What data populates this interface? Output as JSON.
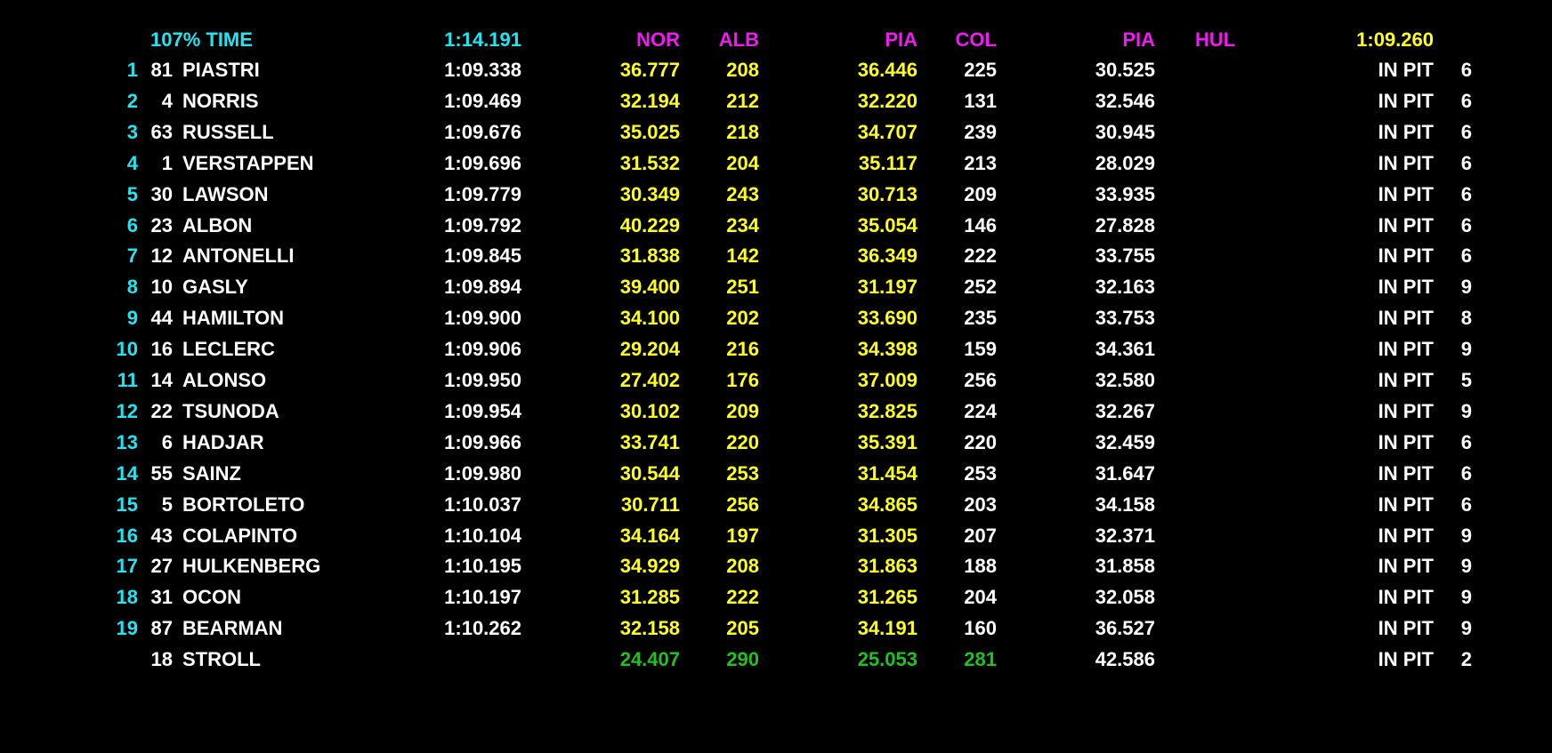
{
  "colors": {
    "background": "#000000",
    "header_label": "#22e5f2",
    "position": "#22e5f2",
    "text": "#ffffff",
    "sector": "#ffff1e",
    "best_marker": "#ee1cee",
    "personal_best": "#22c022"
  },
  "header": {
    "label": "107% TIME",
    "cutoff_time": "1:14.191",
    "best_s1_driver": "NOR",
    "best_sp1_driver": "ALB",
    "best_s2_driver": "PIA",
    "best_sp2_driver": "COL",
    "best_s3_driver": "PIA",
    "best_sp3_driver": "HUL",
    "best_lap_time": "1:09.260"
  },
  "rows": [
    {
      "pos": "1",
      "num": "81",
      "name": "PIASTRI",
      "lap": "1:09.338",
      "s1": "36.777",
      "sp1": "208",
      "s2": "36.446",
      "sp2": "225",
      "s3": "30.525",
      "sp3": "",
      "status": "IN PIT",
      "laps": "6"
    },
    {
      "pos": "2",
      "num": "4",
      "name": "NORRIS",
      "lap": "1:09.469",
      "s1": "32.194",
      "sp1": "212",
      "s2": "32.220",
      "sp2": "131",
      "s3": "32.546",
      "sp3": "",
      "status": "IN PIT",
      "laps": "6"
    },
    {
      "pos": "3",
      "num": "63",
      "name": "RUSSELL",
      "lap": "1:09.676",
      "s1": "35.025",
      "sp1": "218",
      "s2": "34.707",
      "sp2": "239",
      "s3": "30.945",
      "sp3": "",
      "status": "IN PIT",
      "laps": "6"
    },
    {
      "pos": "4",
      "num": "1",
      "name": "VERSTAPPEN",
      "lap": "1:09.696",
      "s1": "31.532",
      "sp1": "204",
      "s2": "35.117",
      "sp2": "213",
      "s3": "28.029",
      "sp3": "",
      "status": "IN PIT",
      "laps": "6"
    },
    {
      "pos": "5",
      "num": "30",
      "name": "LAWSON",
      "lap": "1:09.779",
      "s1": "30.349",
      "sp1": "243",
      "s2": "30.713",
      "sp2": "209",
      "s3": "33.935",
      "sp3": "",
      "status": "IN PIT",
      "laps": "6"
    },
    {
      "pos": "6",
      "num": "23",
      "name": "ALBON",
      "lap": "1:09.792",
      "s1": "40.229",
      "sp1": "234",
      "s2": "35.054",
      "sp2": "146",
      "s3": "27.828",
      "sp3": "",
      "status": "IN PIT",
      "laps": "6"
    },
    {
      "pos": "7",
      "num": "12",
      "name": "ANTONELLI",
      "lap": "1:09.845",
      "s1": "31.838",
      "sp1": "142",
      "s2": "36.349",
      "sp2": "222",
      "s3": "33.755",
      "sp3": "",
      "status": "IN PIT",
      "laps": "6"
    },
    {
      "pos": "8",
      "num": "10",
      "name": "GASLY",
      "lap": "1:09.894",
      "s1": "39.400",
      "sp1": "251",
      "s2": "31.197",
      "sp2": "252",
      "s3": "32.163",
      "sp3": "",
      "status": "IN PIT",
      "laps": "9"
    },
    {
      "pos": "9",
      "num": "44",
      "name": "HAMILTON",
      "lap": "1:09.900",
      "s1": "34.100",
      "sp1": "202",
      "s2": "33.690",
      "sp2": "235",
      "s3": "33.753",
      "sp3": "",
      "status": "IN PIT",
      "laps": "8"
    },
    {
      "pos": "10",
      "num": "16",
      "name": "LECLERC",
      "lap": "1:09.906",
      "s1": "29.204",
      "sp1": "216",
      "s2": "34.398",
      "sp2": "159",
      "s3": "34.361",
      "sp3": "",
      "status": "IN PIT",
      "laps": "9"
    },
    {
      "pos": "11",
      "num": "14",
      "name": "ALONSO",
      "lap": "1:09.950",
      "s1": "27.402",
      "sp1": "176",
      "s2": "37.009",
      "sp2": "256",
      "s3": "32.580",
      "sp3": "",
      "status": "IN PIT",
      "laps": "5"
    },
    {
      "pos": "12",
      "num": "22",
      "name": "TSUNODA",
      "lap": "1:09.954",
      "s1": "30.102",
      "sp1": "209",
      "s2": "32.825",
      "sp2": "224",
      "s3": "32.267",
      "sp3": "",
      "status": "IN PIT",
      "laps": "9"
    },
    {
      "pos": "13",
      "num": "6",
      "name": "HADJAR",
      "lap": "1:09.966",
      "s1": "33.741",
      "sp1": "220",
      "s2": "35.391",
      "sp2": "220",
      "s3": "32.459",
      "sp3": "",
      "status": "IN PIT",
      "laps": "6"
    },
    {
      "pos": "14",
      "num": "55",
      "name": "SAINZ",
      "lap": "1:09.980",
      "s1": "30.544",
      "sp1": "253",
      "s2": "31.454",
      "sp2": "253",
      "s3": "31.647",
      "sp3": "",
      "status": "IN PIT",
      "laps": "6"
    },
    {
      "pos": "15",
      "num": "5",
      "name": "BORTOLETO",
      "lap": "1:10.037",
      "s1": "30.711",
      "sp1": "256",
      "s2": "34.865",
      "sp2": "203",
      "s3": "34.158",
      "sp3": "",
      "status": "IN PIT",
      "laps": "6"
    },
    {
      "pos": "16",
      "num": "43",
      "name": "COLAPINTO",
      "lap": "1:10.104",
      "s1": "34.164",
      "sp1": "197",
      "s2": "31.305",
      "sp2": "207",
      "s3": "32.371",
      "sp3": "",
      "status": "IN PIT",
      "laps": "9"
    },
    {
      "pos": "17",
      "num": "27",
      "name": "HULKENBERG",
      "lap": "1:10.195",
      "s1": "34.929",
      "sp1": "208",
      "s2": "31.863",
      "sp2": "188",
      "s3": "31.858",
      "sp3": "",
      "status": "IN PIT",
      "laps": "9"
    },
    {
      "pos": "18",
      "num": "31",
      "name": "OCON",
      "lap": "1:10.197",
      "s1": "31.285",
      "sp1": "222",
      "s2": "31.265",
      "sp2": "204",
      "s3": "32.058",
      "sp3": "",
      "status": "IN PIT",
      "laps": "9"
    },
    {
      "pos": "19",
      "num": "87",
      "name": "BEARMAN",
      "lap": "1:10.262",
      "s1": "32.158",
      "sp1": "205",
      "s2": "34.191",
      "sp2": "160",
      "s3": "36.527",
      "sp3": "",
      "status": "IN PIT",
      "laps": "9"
    },
    {
      "pos": "",
      "num": "18",
      "name": "STROLL",
      "lap": "",
      "s1": "24.407",
      "sp1": "290",
      "s2": "25.053",
      "sp2": "281",
      "s3": "42.586",
      "sp3": "",
      "status": "IN PIT",
      "laps": "2",
      "highlight": "personal_best"
    }
  ]
}
